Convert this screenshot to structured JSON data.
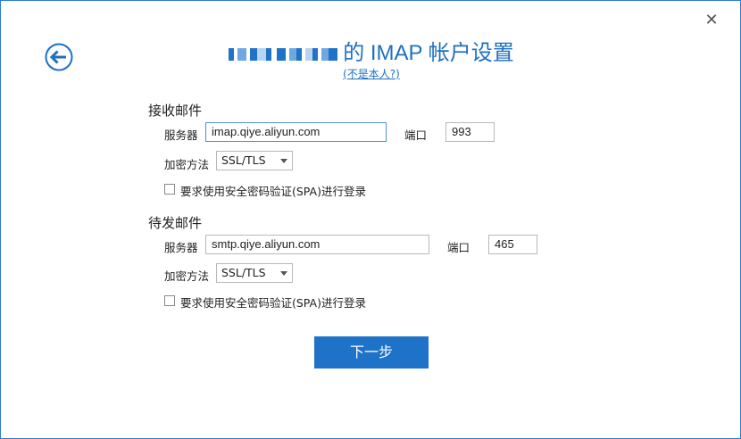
{
  "dialog": {
    "title_suffix": "的 IMAP 帐户设置",
    "not_me_link": "(不是本人?)",
    "close_glyph": "✕"
  },
  "incoming": {
    "section_title": "接收邮件",
    "server_label": "服务器",
    "server_value": "imap.qiye.aliyun.com",
    "port_label": "端口",
    "port_value": "993",
    "encryption_label": "加密方法",
    "encryption_value": "SSL/TLS",
    "spa_label": "要求使用安全密码验证(SPA)进行登录"
  },
  "outgoing": {
    "section_title": "待发邮件",
    "server_label": "服务器",
    "server_value": "smtp.qiye.aliyun.com",
    "port_label": "端口",
    "port_value": "465",
    "encryption_label": "加密方法",
    "encryption_value": "SSL/TLS",
    "spa_label": "要求使用安全密码验证(SPA)进行登录"
  },
  "footer": {
    "next_label": "下一步"
  },
  "colors": {
    "accent": "#1e72c7",
    "title": "#1e6fc0",
    "border": "#2b7cd3"
  }
}
